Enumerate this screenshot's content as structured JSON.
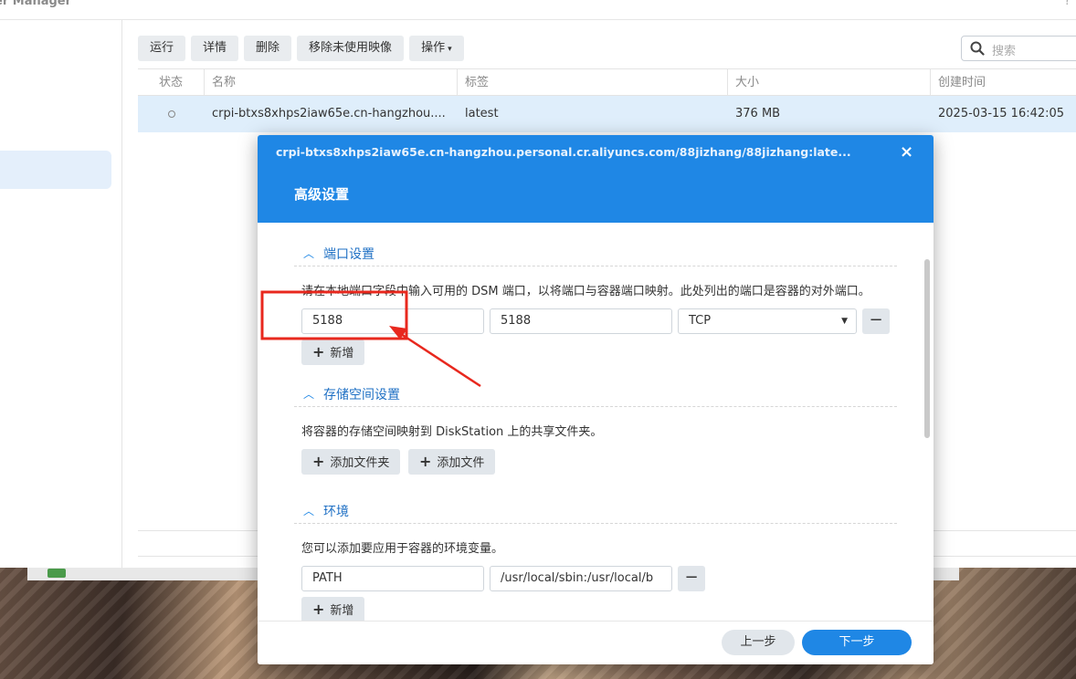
{
  "window": {
    "title": "er Manager",
    "help": "?"
  },
  "toolbar": {
    "run": "运行",
    "details": "详情",
    "delete": "删除",
    "remove_unused": "移除未使用映像",
    "actions": "操作"
  },
  "search": {
    "placeholder": "搜索"
  },
  "table": {
    "headers": [
      "状态",
      "名称",
      "标签",
      "大小",
      "创建时间"
    ],
    "rows": [
      {
        "name": "crpi-btxs8xhps2iaw65e.cn-hangzhou....",
        "tag": "latest",
        "size": "376 MB",
        "created": "2025-03-15 16:42:05"
      }
    ]
  },
  "modal": {
    "path": "crpi-btxs8xhps2iaw65e.cn-hangzhou.personal.cr.aliyuncs.com/88jizhang/88jizhang:late...",
    "close": "×",
    "title": "高级设置",
    "port_section": {
      "title": "端口设置",
      "desc": "请在本地端口字段中输入可用的 DSM 端口，以将端口与容器端口映射。此处列出的端口是容器的对外端口。",
      "local_port": "5188",
      "container_port": "5188",
      "protocol": "TCP",
      "add": "新增"
    },
    "storage_section": {
      "title": "存储空间设置",
      "desc": "将容器的存储空间映射到 DiskStation 上的共享文件夹。",
      "add_folder": "添加文件夹",
      "add_file": "添加文件"
    },
    "env_section": {
      "title": "环境",
      "desc": "您可以添加要应用于容器的环境变量。",
      "var_name": "PATH",
      "var_value": "/usr/local/sbin:/usr/local/b",
      "add": "新增"
    },
    "footer": {
      "prev": "上一步",
      "next": "下一步"
    }
  },
  "colors": {
    "accent": "#1f87e5",
    "selected_row": "#dfeefb",
    "annotation": "#e8281e"
  }
}
